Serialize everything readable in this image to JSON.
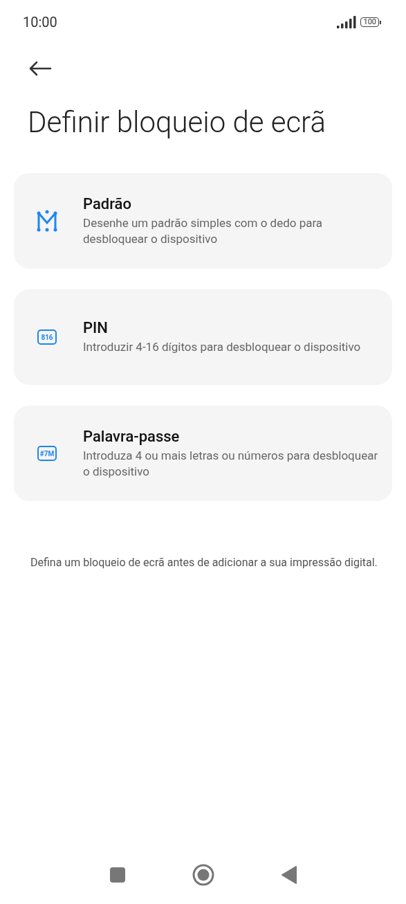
{
  "status_bar": {
    "time": "10:00",
    "battery": "100"
  },
  "title": "Definir bloqueio de ecrã",
  "options": [
    {
      "kind": "pattern",
      "title": "Padrão",
      "description": "Desenhe um padrão simples com o dedo para desbloquear o dispositivo"
    },
    {
      "kind": "pin",
      "icon_text": "816",
      "title": "PIN",
      "description": "Introduzir 4-16 dígitos para desbloquear o dispositivo"
    },
    {
      "kind": "password",
      "icon_text": "#7M",
      "title": "Palavra-passe",
      "description": "Introduza 4 ou mais letras ou números para desbloquear o dispositivo"
    }
  ],
  "note": "Defina um bloqueio de ecrã antes de adicionar a sua impressão digital."
}
